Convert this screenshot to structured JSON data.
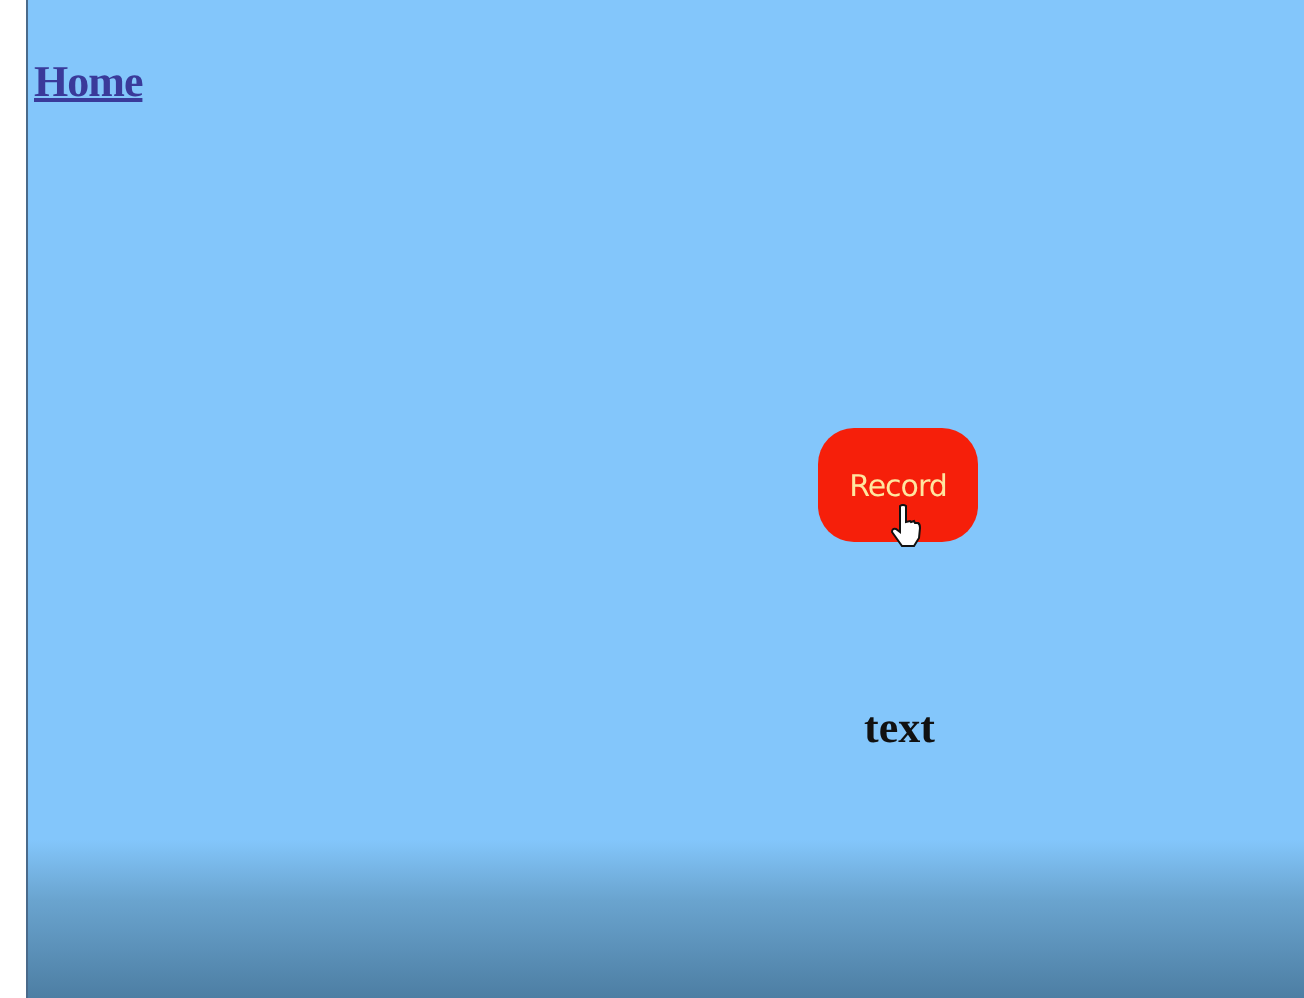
{
  "home_link": "Home",
  "record_button": {
    "label": "Record"
  },
  "caption": "text"
}
